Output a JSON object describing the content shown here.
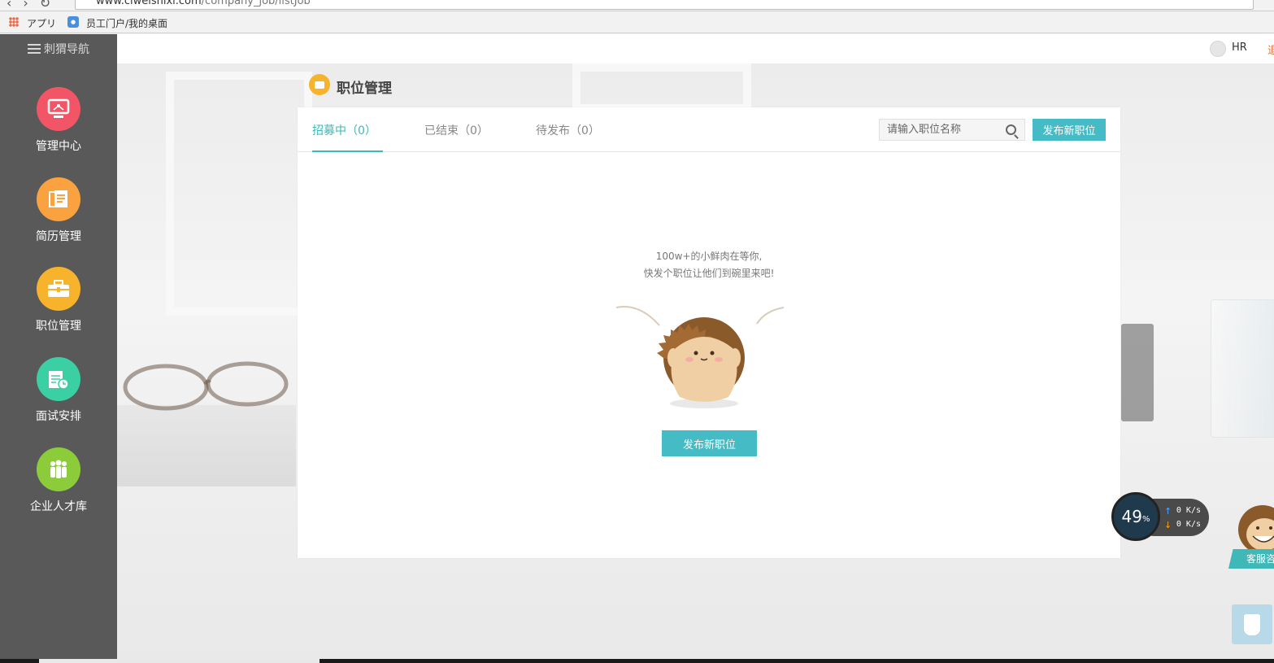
{
  "browser": {
    "url_host": "www.ciweishixi.com",
    "url_path": "/company_job/listJob",
    "bookmarks": {
      "apps_label": "アプリ",
      "link_label": "员工门户/我的桌面"
    }
  },
  "sidebar": {
    "header_label": "刺猬导航",
    "items": [
      {
        "label": "管理中心",
        "color": "#f25565",
        "icon": "monitor-icon"
      },
      {
        "label": "简历管理",
        "color": "#f9a23f",
        "icon": "resume-icon"
      },
      {
        "label": "职位管理",
        "color": "#f7b32b",
        "icon": "briefcase-icon"
      },
      {
        "label": "面试安排",
        "color": "#3bcfa4",
        "icon": "calendar-icon"
      },
      {
        "label": "企业人才库",
        "color": "#8ccc3a",
        "icon": "people-icon"
      }
    ]
  },
  "topbar": {
    "user_name": "HR",
    "logout_partial": "退"
  },
  "page": {
    "title": "职位管理"
  },
  "tabs": [
    {
      "label": "招募中（0）",
      "active": true
    },
    {
      "label": "已结束（0）",
      "active": false
    },
    {
      "label": "待发布（0）",
      "active": false
    }
  ],
  "search": {
    "placeholder": "请输入职位名称"
  },
  "actions": {
    "publish_top": "发布新职位",
    "publish_center": "发布新职位"
  },
  "empty_state": {
    "line1": "100w+的小鲜肉在等你,",
    "line2": "快发个职位让他们到碗里来吧!"
  },
  "speed_widget": {
    "percent": "49",
    "percent_sign": "%",
    "upload": "0 K/s",
    "download": "0 K/s"
  },
  "customer_service": {
    "label": "客服咨"
  },
  "colors": {
    "accent": "#45bcc5",
    "tab_active": "#3fb8b8",
    "sidebar_bg": "#595959"
  }
}
